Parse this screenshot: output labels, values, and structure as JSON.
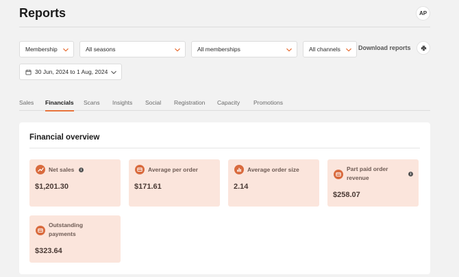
{
  "header": {
    "title": "Reports",
    "avatar_initials": "AP"
  },
  "filters": {
    "membership": "Membership",
    "seasons": "All seasons",
    "memberships": "All memberships",
    "channels": "All channels",
    "date_range": "30 Jun, 2024 to 1 Aug, 2024",
    "download_label": "Download reports"
  },
  "tabs": [
    {
      "label": "Sales",
      "active": false
    },
    {
      "label": "Financials",
      "active": true
    },
    {
      "label": "Scans",
      "active": false
    },
    {
      "label": "Insights",
      "active": false
    },
    {
      "label": "Social",
      "active": false
    },
    {
      "label": "Registration",
      "active": false
    },
    {
      "label": "Capacity",
      "active": false
    },
    {
      "label": "Promotions",
      "active": false
    }
  ],
  "overview": {
    "title": "Financial overview",
    "stats": [
      {
        "label": "Net sales",
        "value": "$1,201.30",
        "icon": "trending-up-icon",
        "has_info": true
      },
      {
        "label": "Average per order",
        "value": "$171.61",
        "icon": "card-icon",
        "has_info": false
      },
      {
        "label": "Average order size",
        "value": "2.14",
        "icon": "bar-chart-icon",
        "has_info": false
      },
      {
        "label": "Part paid order revenue",
        "label_line1": "Part paid order",
        "label_line2": "revenue",
        "value": "$258.07",
        "icon": "card-icon",
        "has_info": true
      },
      {
        "label": "Outstanding payments",
        "label_line1": "Outstanding",
        "label_line2": "payments",
        "value": "$323.64",
        "icon": "card-icon",
        "has_info": false
      }
    ]
  },
  "colors": {
    "accent": "#e8733b",
    "stat_bg": "#fbe5dc",
    "icon_bg": "#d96b3e"
  }
}
